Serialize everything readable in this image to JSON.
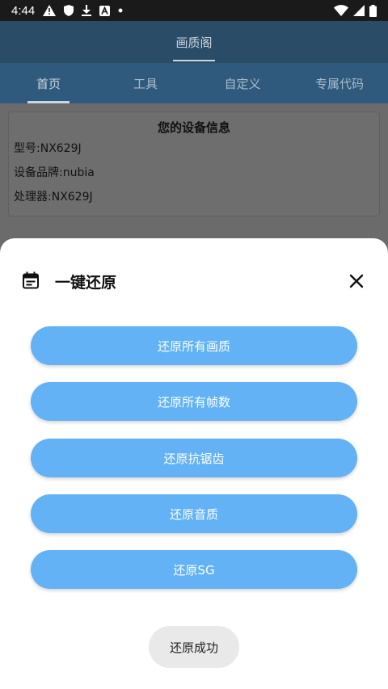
{
  "status_bar": {
    "time": "4:44"
  },
  "app_bar": {
    "title": "画质阁"
  },
  "tabs": [
    {
      "label": "首页",
      "active": true
    },
    {
      "label": "工具",
      "active": false
    },
    {
      "label": "自定义",
      "active": false
    },
    {
      "label": "专属代码",
      "active": false
    }
  ],
  "device_info": {
    "title": "您的设备信息",
    "model": "型号:NX629J",
    "brand": "设备品牌:nubia",
    "processor": "处理器:NX629J"
  },
  "sheet": {
    "title": "一键还原",
    "buttons": [
      "还原所有画质",
      "还原所有帧数",
      "还原抗锯齿",
      "还原音质",
      "还原SG"
    ]
  },
  "toast": {
    "text": "还原成功"
  },
  "colors": {
    "accent_button": "#62b2f5",
    "app_bar": "#2a4c67",
    "tabs": "#2f5a7d"
  },
  "icons": {
    "status": [
      "warning-icon",
      "shield-icon",
      "download-icon",
      "a-icon",
      "dot-icon",
      "wifi-icon",
      "signal-icon",
      "battery-icon"
    ],
    "sheet_header": [
      "calendar-icon",
      "close-icon"
    ]
  }
}
